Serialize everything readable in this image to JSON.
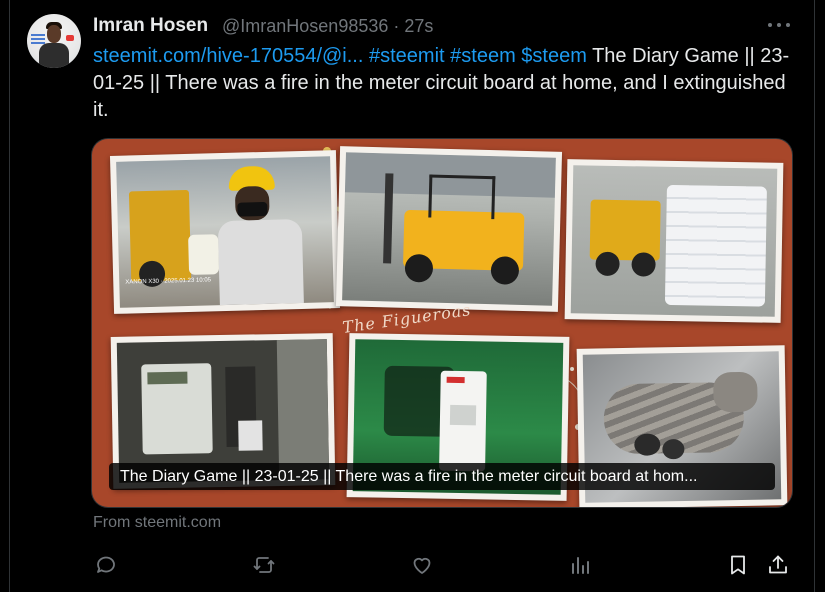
{
  "tweet": {
    "author_name": "Imran Hosen",
    "author_handle": "@ImranHosen98536",
    "separator": "·",
    "time": "27s",
    "link_text": "steemit.com/hive-170554/@i...",
    "hashtags": [
      "#steemit",
      "#steem",
      "$steem"
    ],
    "body_text": "The Diary Game || 23-01-25 || There was a fire in the meter circuit board at home, and I extinguished it."
  },
  "card": {
    "caption": "The Diary Game || 23-01-25 || There was a fire in the meter circuit board at hom...",
    "source": "From steemit.com",
    "watermark": "The Figueroas",
    "photo_stamps": [
      "XANON X30 · 2025.01.23 10:05"
    ]
  },
  "actions": [
    "reply-icon",
    "retweet-icon",
    "like-icon",
    "views-icon",
    "bookmark-icon",
    "share-icon"
  ],
  "colors": {
    "background": "#000000",
    "text": "#e7e9ea",
    "muted": "#71767b",
    "link": "#1d9bf0",
    "card_bg": "#a8472a"
  }
}
